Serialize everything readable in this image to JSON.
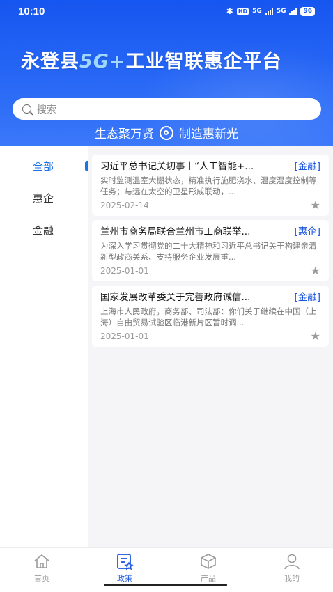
{
  "status": {
    "time": "10:10",
    "bluetooth": "✱",
    "hd": "HD",
    "net1": "5G",
    "net2": "5G",
    "battery": "96"
  },
  "header": {
    "title_pre": "永登县",
    "title_hl": "5G+",
    "title_post": "工业智联惠企平台",
    "search_placeholder": "搜索",
    "slogan_left": "生态聚万贤",
    "slogan_right": "制造惠新光"
  },
  "sidebar": {
    "items": [
      {
        "label": "全部",
        "active": true
      },
      {
        "label": "惠企",
        "active": false
      },
      {
        "label": "金融",
        "active": false
      }
    ]
  },
  "cards": [
    {
      "title": "习近平总书记关切事丨“人工智能+...",
      "tag": "[金融]",
      "summary": "实时监测温室大棚状态，精准执行施肥浇水、温度湿度控制等任务；与远在太空的卫星形成联动，...",
      "date": "2025-02-14"
    },
    {
      "title": "兰州市商务局联合兰州市工商联举...",
      "tag": "[惠企]",
      "summary": "为深入学习贯彻党的二十大精神和习近平总书记关于构建亲清新型政商关系、支持服务企业发展重...",
      "date": "2025-01-01"
    },
    {
      "title": "国家发展改革委关于完善政府诚信...",
      "tag": "[金融]",
      "summary": "上海市人民政府，商务部、司法部：你们关于继续在中国（上海）自由贸易试验区临港新片区暂时调...",
      "date": "2025-01-01"
    }
  ],
  "nav": [
    {
      "label": "首页",
      "icon": "home-icon",
      "active": false
    },
    {
      "label": "政策",
      "icon": "policy-icon",
      "active": true
    },
    {
      "label": "产品",
      "icon": "product-box-icon",
      "active": false
    },
    {
      "label": "我的",
      "icon": "user-icon",
      "active": false
    }
  ],
  "colors": {
    "header_blue": "#1656f0",
    "accent": "#1a55e0",
    "tag": "#1a55e0"
  }
}
